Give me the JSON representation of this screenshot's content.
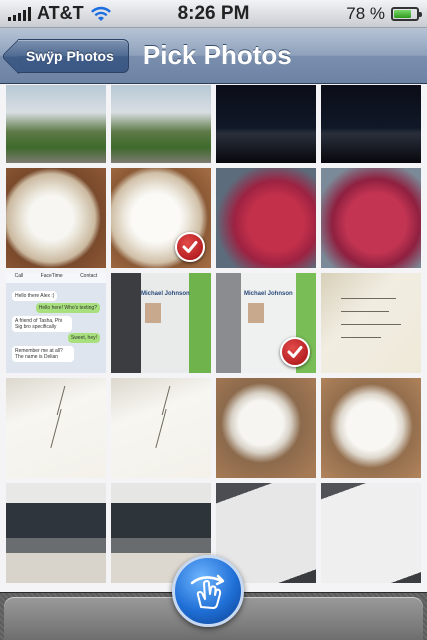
{
  "status_bar": {
    "carrier": "AT&T",
    "time": "8:26 PM",
    "battery_percent": "78 %",
    "battery_level": 0.78,
    "icons": [
      "signal-bars-icon",
      "wifi-icon",
      "battery-icon"
    ]
  },
  "nav_bar": {
    "back_label": "Swÿp Photos",
    "title": "Pick Photos"
  },
  "sms_preview": {
    "tabs": [
      "Call",
      "FaceTime",
      "Contact"
    ],
    "messages": [
      {
        "text": "Hello there Alex :)",
        "sender": "them"
      },
      {
        "text": "Hello here! Who's texting?",
        "sender": "me"
      },
      {
        "text": "A friend of Tasha, Phi Sig bro specifically",
        "sender": "them"
      },
      {
        "text": "Sweet, hey!",
        "sender": "me"
      },
      {
        "text": "Remember me at all? The name is Delian",
        "sender": "them"
      }
    ]
  },
  "name_tag": {
    "name": "Michael Johnson"
  },
  "colors": {
    "nav_gradient_top": "#b7c4d6",
    "nav_gradient_bottom": "#6d83a4",
    "back_button": "#3f5c87",
    "check_badge": "#b5161a",
    "swype_button": "#1f6fd6"
  },
  "photos": [
    {
      "id": "campus-lawn-1",
      "selected": false
    },
    {
      "id": "campus-lawn-2",
      "selected": false
    },
    {
      "id": "night-harbor-1",
      "selected": false
    },
    {
      "id": "night-harbor-2",
      "selected": false
    },
    {
      "id": "latte-art-1",
      "selected": false
    },
    {
      "id": "latte-art-2",
      "selected": true
    },
    {
      "id": "red-tree-1",
      "selected": false
    },
    {
      "id": "red-tree-2",
      "selected": false
    },
    {
      "id": "sms-screenshot",
      "selected": false
    },
    {
      "id": "name-tag-1",
      "selected": false
    },
    {
      "id": "name-tag-2",
      "selected": true
    },
    {
      "id": "handwritten-note-1",
      "selected": false
    },
    {
      "id": "handwritten-note-2",
      "selected": false
    },
    {
      "id": "handwritten-note-3",
      "selected": false
    },
    {
      "id": "coffee-cup-1",
      "selected": false
    },
    {
      "id": "coffee-cup-2",
      "selected": false
    },
    {
      "id": "classroom-1",
      "selected": false
    },
    {
      "id": "classroom-2",
      "selected": false
    },
    {
      "id": "worksheet-1",
      "selected": false
    },
    {
      "id": "worksheet-2",
      "selected": false
    }
  ],
  "toolbar": {
    "swype_button_icon": "swipe-gesture-icon"
  }
}
